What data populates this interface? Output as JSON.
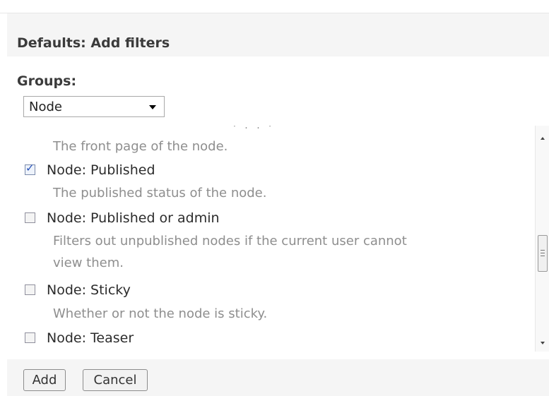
{
  "dialog": {
    "title": "Defaults: Add filters"
  },
  "groups": {
    "label": "Groups:",
    "selected": "Node"
  },
  "filters": {
    "partial_top_description": "The front page of the node.",
    "items": [
      {
        "label": "Node: Published",
        "checked": true,
        "description": "The published status of the node."
      },
      {
        "label": "Node: Published or admin",
        "checked": false,
        "description_lines": [
          "Filters out unpublished nodes if the current user cannot",
          "view them."
        ]
      },
      {
        "label": "Node: Sticky",
        "checked": false,
        "description": "Whether or not the node is sticky."
      },
      {
        "label": "Node: Teaser",
        "checked": false
      }
    ]
  },
  "buttons": {
    "add": "Add",
    "cancel": "Cancel"
  },
  "colors": {
    "panel_bg": "#f5f5f5",
    "description_text": "#8e8e8e",
    "check_mark": "#2550b8"
  },
  "icons": {
    "checkbox_checked": "check-mark",
    "select_arrow": "chevron-down",
    "scroll_up": "arrow-up",
    "scroll_down": "arrow-down"
  }
}
